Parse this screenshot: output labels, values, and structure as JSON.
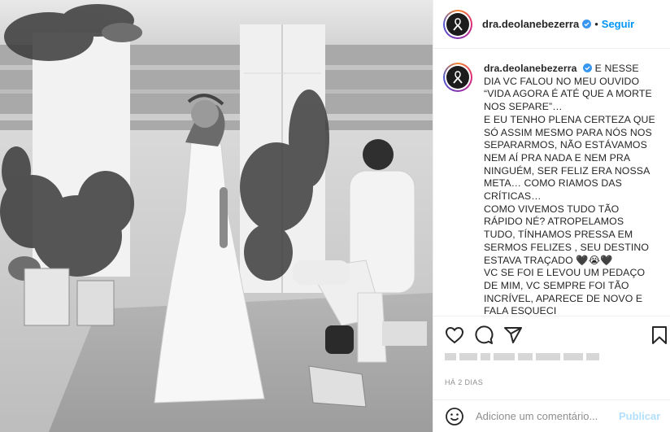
{
  "post": {
    "username": "dra.deolanebezerra",
    "verified": true,
    "follow_label": "Seguir",
    "separator": "•",
    "caption_text": "E NESSE DIA VC FALOU NO MEU OUVIDO “VIDA AGORA É ATÉ QUE A MORTE NOS SEPARE”…\nE EU TENHO PLENA CERTEZA QUE SÓ ASSIM MESMO PARA NÓS NOS SEPARARMOS, NÃO ESTÁVAMOS NEM AÍ PRA NADA E NEM PRA NINGUÉM, SER FELIZ ERA NOSSA META… COMO RIAMOS DAS CRÍTICAS…\nCOMO VIVEMOS TUDO TÃO RÁPIDO NÉ? ATROPELAMOS TUDO, TÍNHAMOS PRESSA EM SERMOS FELIZES , SEU DESTINO ESTAVA TRAÇADO 🖤😭🖤\nVC SE FOI E LEVOU UM PEDAÇO DE MIM, VC SEMPRE FOI TÃO INCRÍVEL, APARECE DE NOVO E FALA ESQUECI",
    "date": "HÁ 2 DIAS"
  },
  "comment_box": {
    "placeholder": "Adicione um comentário...",
    "publish_label": "Publicar"
  },
  "colors": {
    "link_blue": "#0095f6",
    "publish_disabled": "#b2dffc",
    "border": "#efefef",
    "muted": "#8e8e8e"
  },
  "icons": [
    "heart-icon",
    "comment-icon",
    "share-icon",
    "bookmark-icon",
    "emoji-icon",
    "verified-badge-icon"
  ]
}
